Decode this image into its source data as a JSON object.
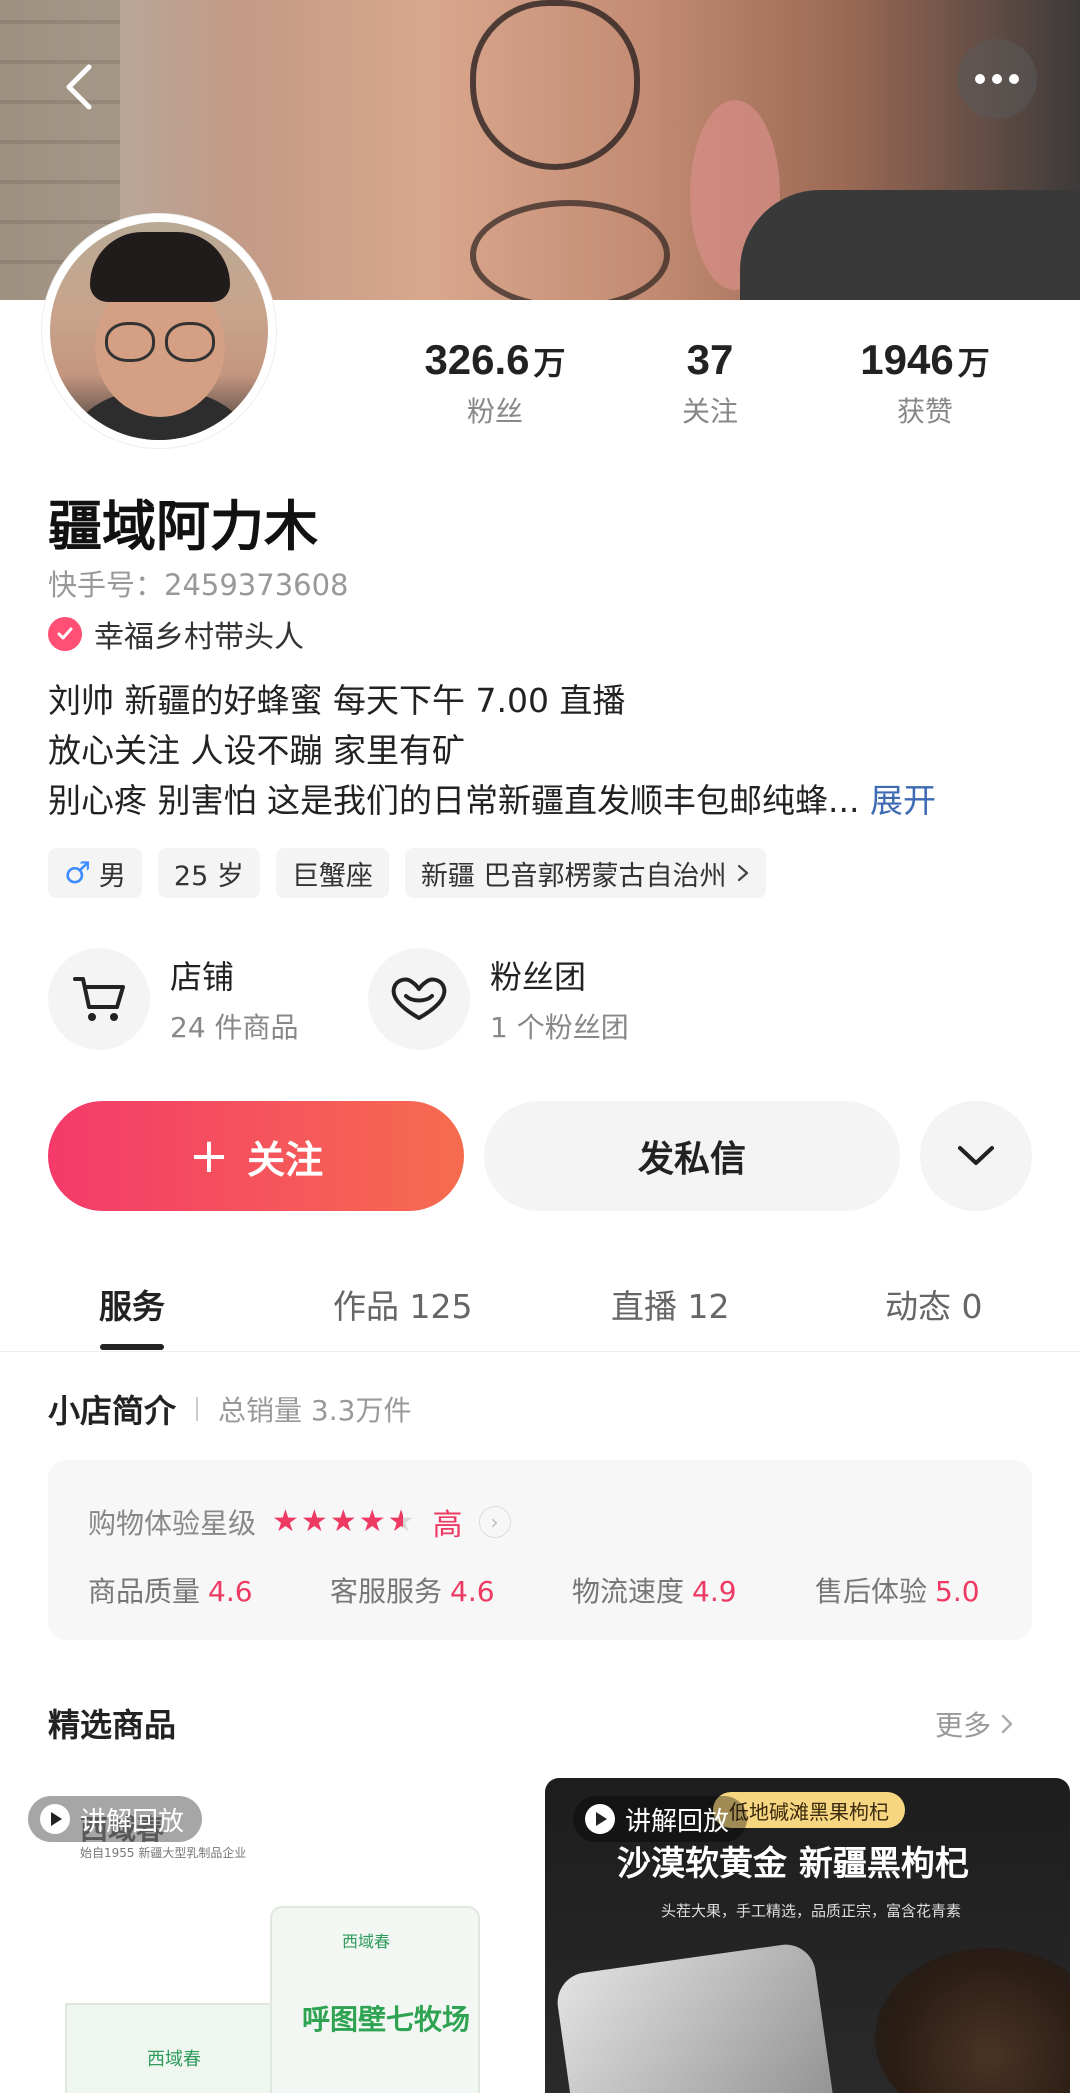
{
  "profile": {
    "name": "疆域阿力木",
    "kuaishou_id": "快手号：2459373608",
    "certification": "幸福乡村带头人",
    "stats": [
      {
        "num": "326.6",
        "unit": "万",
        "label": "粉丝"
      },
      {
        "num": "37",
        "unit": "",
        "label": "关注"
      },
      {
        "num": "1946",
        "unit": "万",
        "label": "获赞"
      }
    ],
    "bio_lines": [
      "刘帅   新疆的好蜂蜜 每天下午 7.00 直播",
      "放心关注 人设不蹦 家里有矿",
      "别心疼 别害怕 这是我们的日常新疆直发顺丰包邮纯蜂..."
    ],
    "bio_expand": "展开",
    "tags": {
      "gender_symbol": "♂",
      "gender": "男",
      "age": "25 岁",
      "zodiac": "巨蟹座",
      "location": "新疆 巴音郭楞蒙古自治州"
    }
  },
  "entries": {
    "shop": {
      "title": "店铺",
      "sub": "24 件商品"
    },
    "fans_club": {
      "title": "粉丝团",
      "sub": "1 个粉丝团"
    }
  },
  "actions": {
    "follow_plus": "+",
    "follow": "关注",
    "message": "发私信"
  },
  "tabs": [
    {
      "label": "服务"
    },
    {
      "label": "作品 125"
    },
    {
      "label": "直播 12"
    },
    {
      "label": "动态 0"
    }
  ],
  "shop_intro": {
    "title": "小店简介",
    "sales": "总销量 3.3万件",
    "rating_label": "购物体验星级",
    "rating_stars": 4.5,
    "rating_level": "高",
    "metrics": [
      {
        "label": "商品质量",
        "value": "4.6"
      },
      {
        "label": "客服服务",
        "value": "4.6"
      },
      {
        "label": "物流速度",
        "value": "4.9"
      },
      {
        "label": "售后体验",
        "value": "5.0"
      }
    ]
  },
  "featured": {
    "title": "精选商品",
    "more": "更多",
    "items": [
      {
        "replay": "讲解回放",
        "brand": "西域春",
        "brand_sub": "始自1955 新疆大型乳制品企业",
        "box_label": "西域春",
        "bag_brand": "西域春",
        "bag_label": "呼图壁七牧场"
      },
      {
        "replay": "讲解回放",
        "pill": "低地碱滩黑果枸杞",
        "title": "沙漠软黄金 新疆黑枸杞",
        "desc": "头茬大果，手工精选，品质正宗，富含花青素"
      }
    ]
  },
  "colors": {
    "accent": "#ee3a63",
    "follow_gradient_start": "#f43a6a",
    "follow_gradient_end": "#f66c4f",
    "link": "#3d6bb3"
  },
  "icons": {
    "back": "chevron-left-icon",
    "more": "more-dots-icon",
    "verified": "check-badge-icon",
    "shop": "cart-icon",
    "fans": "heart-icon",
    "dropdown": "chevron-down-icon"
  }
}
